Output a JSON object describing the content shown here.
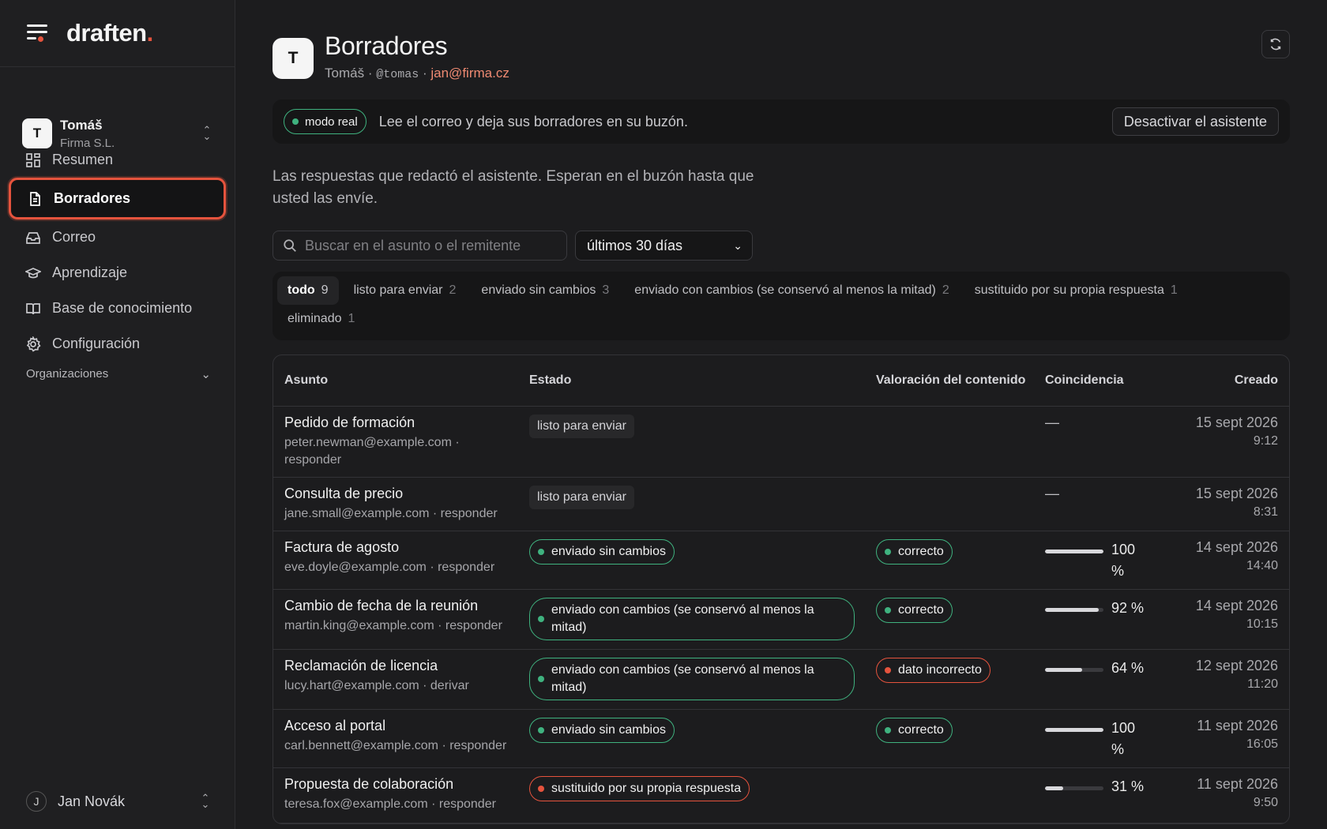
{
  "app": {
    "logo": "draften",
    "logo_dot": "."
  },
  "workspace": {
    "initial": "T",
    "name": "Tomáš",
    "org": "Firma S.L."
  },
  "nav": [
    {
      "label": "Resumen",
      "icon": "dashboard-icon"
    },
    {
      "label": "Borradores",
      "icon": "document-icon",
      "active": true
    },
    {
      "label": "Correo",
      "icon": "inbox-icon"
    },
    {
      "label": "Aprendizaje",
      "icon": "graduation-cap-icon"
    },
    {
      "label": "Base de conocimiento",
      "icon": "book-icon"
    },
    {
      "label": "Configuración",
      "icon": "gear-icon"
    }
  ],
  "orgs_label": "Organizaciones",
  "user": {
    "initial": "J",
    "name": "Jan Novák"
  },
  "header": {
    "initial": "T",
    "title": "Borradores",
    "name": "Tomáš",
    "sep": "·",
    "handle": "@tomas",
    "email": "jan@firma.cz"
  },
  "banner": {
    "mode": "modo real",
    "text": "Lee el correo y deja sus borradores en su buzón.",
    "button": "Desactivar el asistente"
  },
  "intro": "Las respuestas que redactó el asistente. Esperan en el buzón hasta que usted las envíe.",
  "search": {
    "placeholder": "Buscar en el asunto o el remitente"
  },
  "period": {
    "selected": "últimos 30 días"
  },
  "tabs": [
    {
      "label": "todo",
      "count": "9",
      "active": true
    },
    {
      "label": "listo para enviar",
      "count": "2"
    },
    {
      "label": "enviado sin cambios",
      "count": "3"
    },
    {
      "label": "enviado con cambios (se conservó al menos la mitad)",
      "count": "2"
    },
    {
      "label": "sustituido por su propia respuesta",
      "count": "1"
    },
    {
      "label": "eliminado",
      "count": "1"
    }
  ],
  "table": {
    "headers": {
      "subject": "Asunto",
      "status": "Estado",
      "rating": "Valoración del contenido",
      "match": "Coincidencia",
      "created": "Creado"
    },
    "rows": [
      {
        "subject": "Pedido de formación",
        "meta": "peter.newman@example.com · responder",
        "status": "listo para enviar",
        "status_kind": "chip",
        "rating": "",
        "match": "—",
        "match_value": null,
        "date": "15 sept 2026",
        "time": "9:12"
      },
      {
        "subject": "Consulta de precio",
        "meta": "jane.small@example.com · responder",
        "status": "listo para enviar",
        "status_kind": "chip",
        "rating": "",
        "match": "—",
        "match_value": null,
        "date": "15 sept 2026",
        "time": "8:31"
      },
      {
        "subject": "Factura de agosto",
        "meta": "eve.doyle@example.com · responder",
        "status": "enviado sin cambios",
        "status_kind": "green",
        "rating": "correcto",
        "rating_kind": "green",
        "match": "100 %",
        "match_value": 100,
        "date": "14 sept 2026",
        "time": "14:40"
      },
      {
        "subject": "Cambio de fecha de la reunión",
        "meta": "martin.king@example.com · responder",
        "status": "enviado con cambios (se conservó al menos la mitad)",
        "status_kind": "green-wide",
        "rating": "correcto",
        "rating_kind": "green",
        "match": "92 %",
        "match_value": 92,
        "date": "14 sept 2026",
        "time": "10:15"
      },
      {
        "subject": "Reclamación de licencia",
        "meta": "lucy.hart@example.com · derivar",
        "status": "enviado con cambios (se conservó al menos la mitad)",
        "status_kind": "green-wide",
        "rating": "dato incorrecto",
        "rating_kind": "red",
        "match": "64 %",
        "match_value": 64,
        "date": "12 sept 2026",
        "time": "11:20"
      },
      {
        "subject": "Acceso al portal",
        "meta": "carl.bennett@example.com · responder",
        "status": "enviado sin cambios",
        "status_kind": "green",
        "rating": "correcto",
        "rating_kind": "green",
        "match": "100 %",
        "match_value": 100,
        "date": "11 sept 2026",
        "time": "16:05"
      },
      {
        "subject": "Propuesta de colaboración",
        "meta": "teresa.fox@example.com · responder",
        "status": "sustituido por su propia respuesta",
        "status_kind": "red",
        "rating": "",
        "match": "31 %",
        "match_value": 31,
        "date": "11 sept 2026",
        "time": "9:50"
      }
    ]
  }
}
